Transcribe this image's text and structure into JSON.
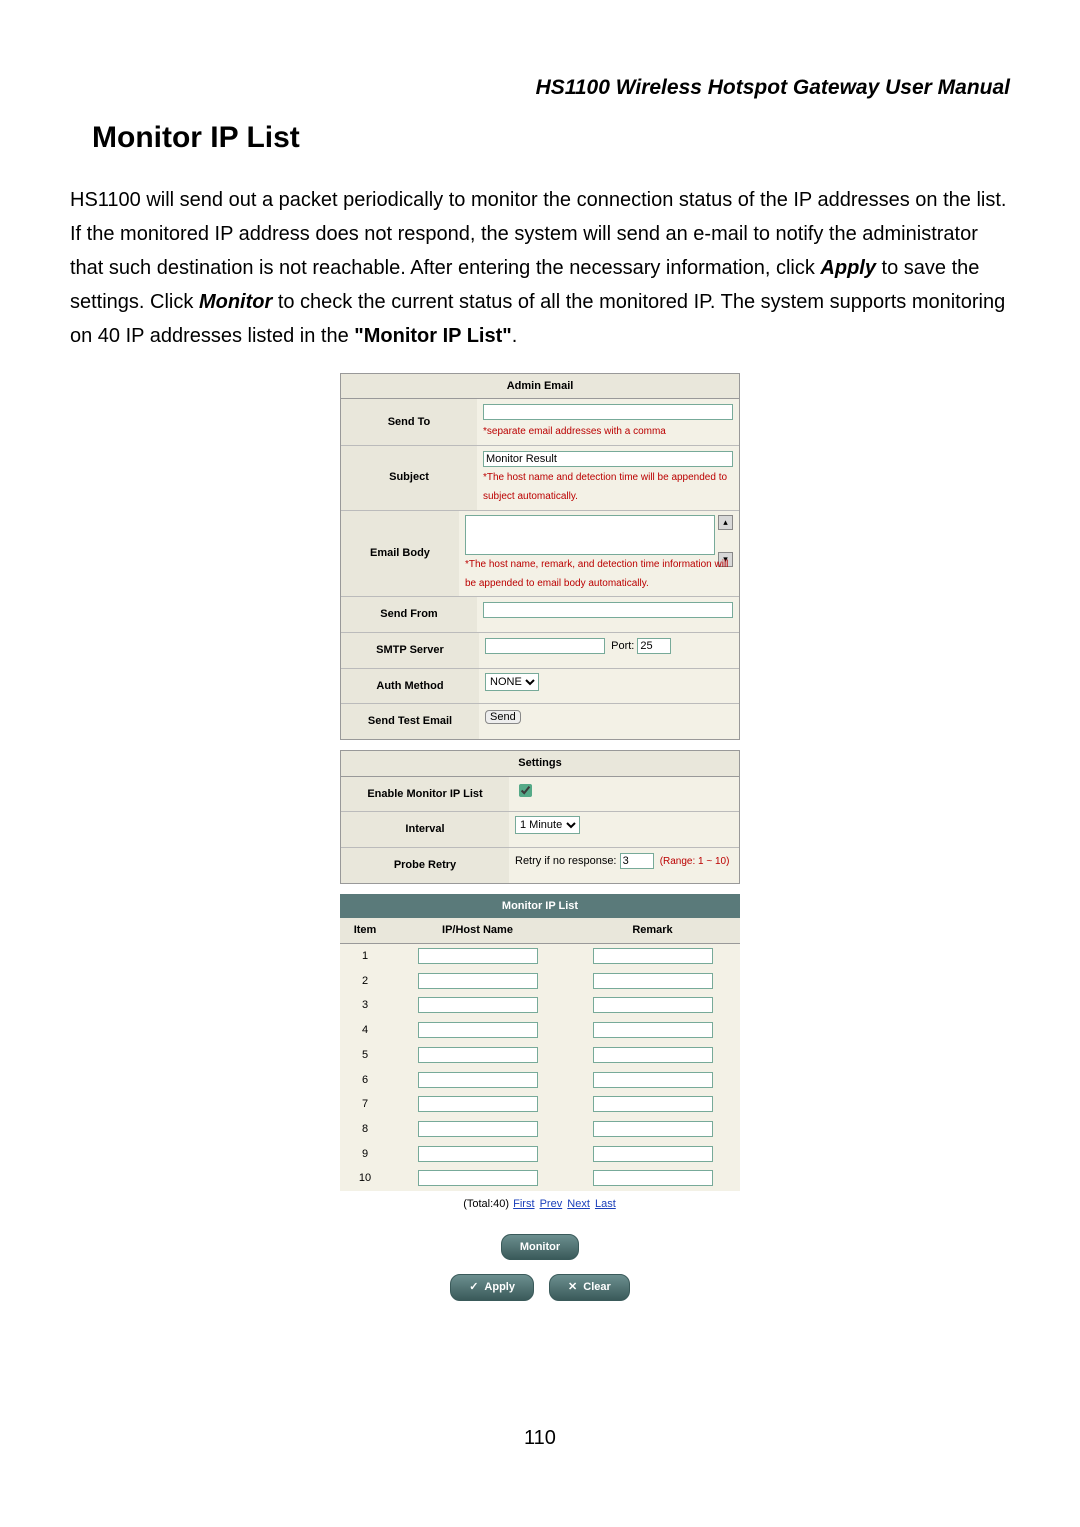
{
  "header": {
    "manual_title": "HS1100 Wireless Hotspot Gateway User Manual"
  },
  "section": {
    "title": "Monitor IP List"
  },
  "paragraph": {
    "p1a": "HS1100 will send out a packet periodically to monitor the connection status of the IP addresses on the list. If the monitored IP address does not respond, the system will send an e-mail to notify the administrator that such destination is not reachable. After entering the necessary information, click ",
    "apply": "Apply",
    "p1b": " to save the settings. Click ",
    "monitor": "Monitor",
    "p1c": " to check the current status of all the monitored IP. The system supports monitoring on 40 IP addresses listed in the ",
    "listname": "\"Monitor IP List\"",
    "period": "."
  },
  "admin_email": {
    "header": "Admin Email",
    "send_to": {
      "label": "Send To",
      "value": "",
      "note": "*separate email addresses with a comma"
    },
    "subject": {
      "label": "Subject",
      "value": "Monitor Result",
      "note": "*The host name and detection time will be appended to subject automatically."
    },
    "email_body": {
      "label": "Email Body",
      "value": "",
      "note": "*The host name, remark, and detection time information will be appended to email body automatically."
    },
    "send_from": {
      "label": "Send From",
      "value": ""
    },
    "smtp": {
      "label": "SMTP Server",
      "value": "",
      "port_label": "Port:",
      "port_value": "25"
    },
    "auth_method": {
      "label": "Auth Method",
      "value": "NONE"
    },
    "send_test": {
      "label": "Send Test Email",
      "button": "Send"
    }
  },
  "settings": {
    "header": "Settings",
    "enable": {
      "label": "Enable Monitor IP List",
      "checked": true
    },
    "interval": {
      "label": "Interval",
      "value": "1 Minute"
    },
    "probe_retry": {
      "label": "Probe Retry",
      "prefix": "Retry if no response:",
      "value": "3",
      "range": "(Range: 1 ~ 10)"
    }
  },
  "ip_list": {
    "header": "Monitor IP List",
    "cols": {
      "item": "Item",
      "host": "IP/Host Name",
      "remark": "Remark"
    },
    "rows": [
      {
        "item": "1",
        "host": "",
        "remark": ""
      },
      {
        "item": "2",
        "host": "",
        "remark": ""
      },
      {
        "item": "3",
        "host": "",
        "remark": ""
      },
      {
        "item": "4",
        "host": "",
        "remark": ""
      },
      {
        "item": "5",
        "host": "",
        "remark": ""
      },
      {
        "item": "6",
        "host": "",
        "remark": ""
      },
      {
        "item": "7",
        "host": "",
        "remark": ""
      },
      {
        "item": "8",
        "host": "",
        "remark": ""
      },
      {
        "item": "9",
        "host": "",
        "remark": ""
      },
      {
        "item": "10",
        "host": "",
        "remark": ""
      }
    ],
    "pager": {
      "total": "(Total:40)",
      "first": "First",
      "prev": "Prev",
      "next": "Next",
      "last": "Last"
    }
  },
  "buttons": {
    "monitor": "Monitor",
    "apply": "Apply",
    "clear": "Clear"
  },
  "page_number": "110"
}
